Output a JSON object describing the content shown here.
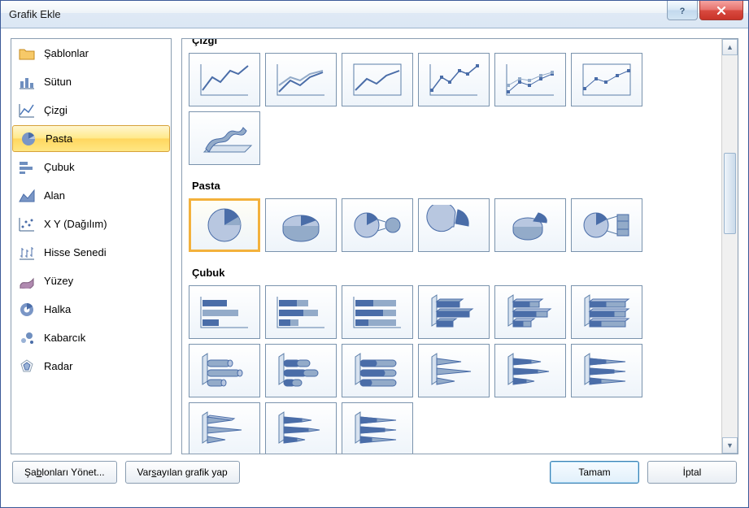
{
  "window": {
    "title": "Grafik Ekle"
  },
  "sidebar": {
    "items": [
      {
        "label": "Şablonlar",
        "icon": "folder",
        "selected": false
      },
      {
        "label": "Sütun",
        "icon": "column",
        "selected": false
      },
      {
        "label": "Çizgi",
        "icon": "line",
        "selected": false
      },
      {
        "label": "Pasta",
        "icon": "pie",
        "selected": true
      },
      {
        "label": "Çubuk",
        "icon": "bar",
        "selected": false
      },
      {
        "label": "Alan",
        "icon": "area",
        "selected": false
      },
      {
        "label": "X Y (Dağılım)",
        "icon": "scatter",
        "selected": false
      },
      {
        "label": "Hisse Senedi",
        "icon": "stock",
        "selected": false
      },
      {
        "label": "Yüzey",
        "icon": "surface",
        "selected": false
      },
      {
        "label": "Halka",
        "icon": "doughnut",
        "selected": false
      },
      {
        "label": "Kabarcık",
        "icon": "bubble",
        "selected": false
      },
      {
        "label": "Radar",
        "icon": "radar",
        "selected": false
      }
    ]
  },
  "gallery": {
    "categories": [
      {
        "title": "Çizgi",
        "clipped_top": true,
        "thumbs": [
          {
            "name": "line-basic",
            "selected": false
          },
          {
            "name": "line-stacked",
            "selected": false
          },
          {
            "name": "line-100stacked",
            "selected": false
          },
          {
            "name": "line-markers",
            "selected": false
          },
          {
            "name": "line-stacked-markers",
            "selected": false
          },
          {
            "name": "line-100-markers",
            "selected": false
          },
          {
            "name": "line-3d",
            "selected": false
          }
        ]
      },
      {
        "title": "Pasta",
        "thumbs": [
          {
            "name": "pie-basic",
            "selected": true
          },
          {
            "name": "pie-3d",
            "selected": false
          },
          {
            "name": "pie-of-pie",
            "selected": false
          },
          {
            "name": "pie-exploded",
            "selected": false
          },
          {
            "name": "pie-exploded-3d",
            "selected": false
          },
          {
            "name": "bar-of-pie",
            "selected": false
          }
        ]
      },
      {
        "title": "Çubuk",
        "thumbs": [
          {
            "name": "bar-clustered",
            "selected": false
          },
          {
            "name": "bar-stacked",
            "selected": false
          },
          {
            "name": "bar-100stacked",
            "selected": false
          },
          {
            "name": "bar-3d-clustered",
            "selected": false
          },
          {
            "name": "bar-3d-stacked",
            "selected": false
          },
          {
            "name": "bar-3d-100stacked",
            "selected": false
          },
          {
            "name": "bar-cylinder",
            "selected": false
          },
          {
            "name": "bar-cylinder-stacked",
            "selected": false
          },
          {
            "name": "bar-cylinder-100",
            "selected": false
          },
          {
            "name": "bar-cone",
            "selected": false
          },
          {
            "name": "bar-cone-stacked",
            "selected": false
          },
          {
            "name": "bar-cone-100",
            "selected": false
          },
          {
            "name": "bar-pyramid",
            "selected": false
          },
          {
            "name": "bar-pyramid-stacked",
            "selected": false
          },
          {
            "name": "bar-pyramid-100",
            "selected": false
          }
        ]
      }
    ]
  },
  "footer": {
    "manage_templates": "Şablonları Yönet...",
    "manage_templates_uchar": "b",
    "set_default": "Varsayılan grafik yap",
    "set_default_uchar": "s",
    "ok": "Tamam",
    "cancel": "İptal"
  }
}
